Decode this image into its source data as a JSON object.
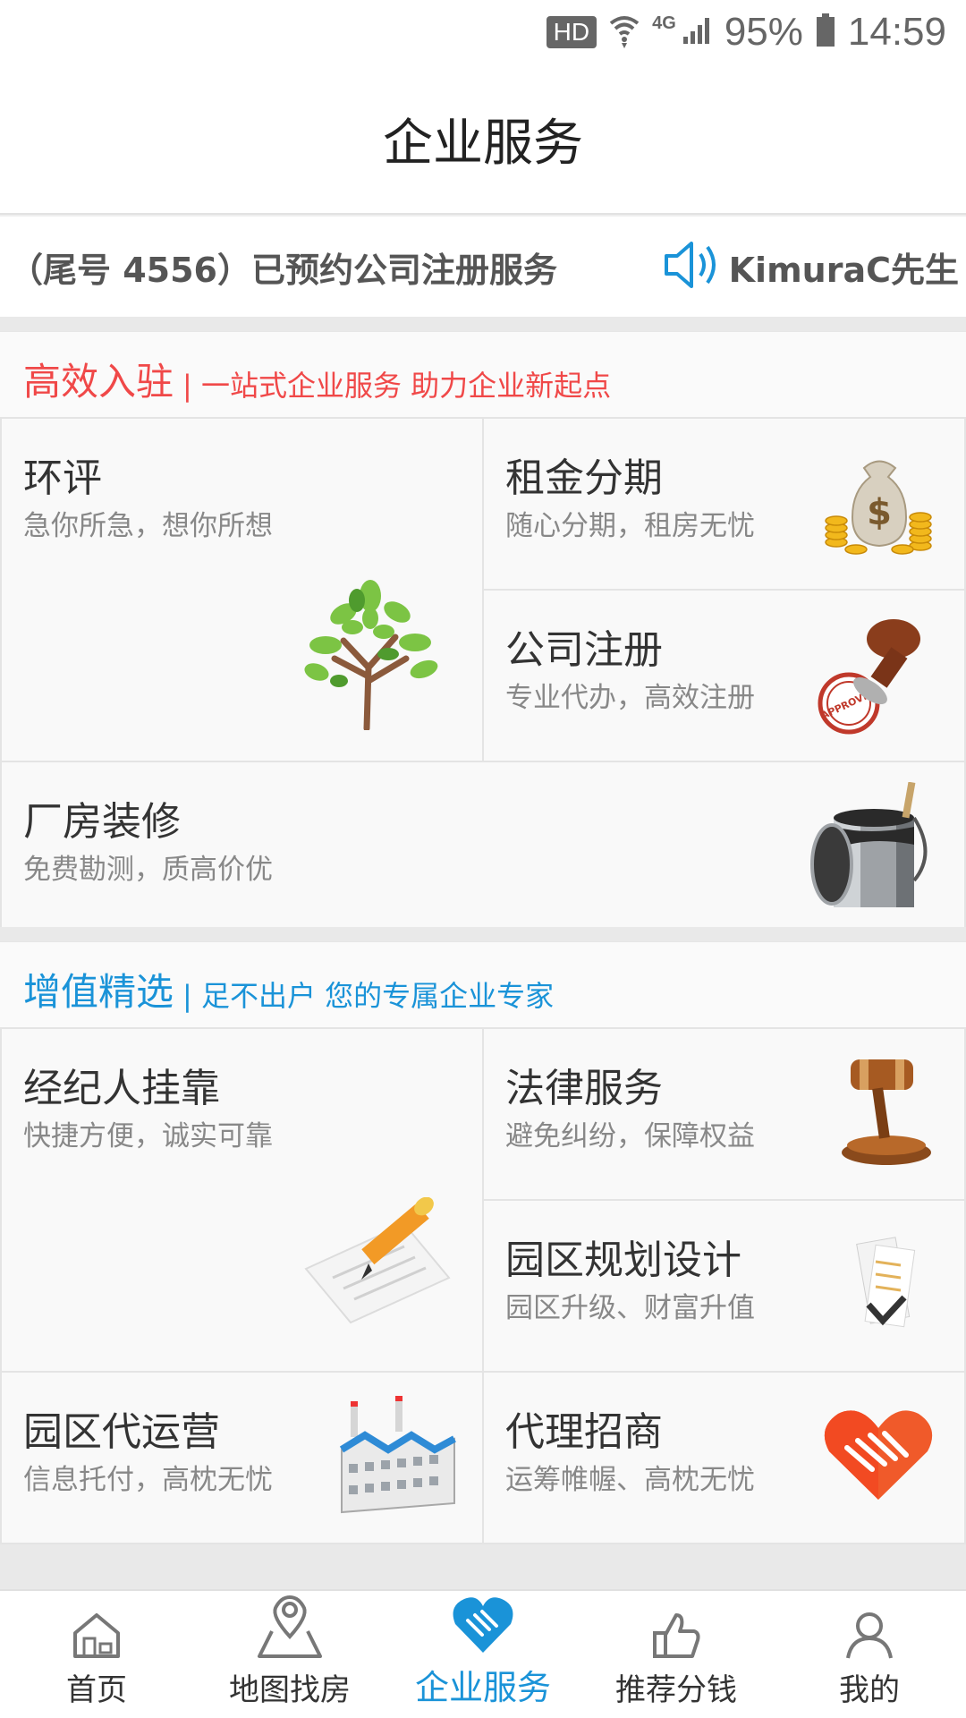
{
  "status_bar": {
    "hd": "HD",
    "network": "4G",
    "battery": "95%",
    "time": "14:59"
  },
  "page_title": "企业服务",
  "notice": {
    "text": "（尾号 4556）已预约公司注册服务",
    "user": "KimuraC先生"
  },
  "section1": {
    "title": "高效入驻",
    "subtitle": "| 一站式企业服务 助力企业新起点",
    "items": [
      {
        "title": "环评",
        "subtitle": "急你所急，想你所想",
        "icon": "tree-icon"
      },
      {
        "title": "租金分期",
        "subtitle": "随心分期，租房无忧",
        "icon": "money-bag-icon"
      },
      {
        "title": "公司注册",
        "subtitle": "专业代办，高效注册",
        "icon": "stamp-icon"
      },
      {
        "title": "厂房装修",
        "subtitle": "免费勘测，质高价优",
        "icon": "paint-bucket-icon"
      }
    ]
  },
  "section2": {
    "title": "增值精选",
    "subtitle": "| 足不出户 您的专属企业专家",
    "items": [
      {
        "title": "经纪人挂靠",
        "subtitle": "快捷方便，诚实可靠",
        "icon": "pencil-paper-icon"
      },
      {
        "title": "法律服务",
        "subtitle": "避免纠纷，保障权益",
        "icon": "gavel-icon"
      },
      {
        "title": "园区规划设计",
        "subtitle": "园区升级、财富升值",
        "icon": "blueprint-icon"
      },
      {
        "title": "园区代运营",
        "subtitle": "信息托付，高枕无忧",
        "icon": "factory-icon"
      },
      {
        "title": "代理招商",
        "subtitle": "运筹帷幄、高枕无忧",
        "icon": "heart-handshake-icon"
      }
    ]
  },
  "tabs": [
    {
      "label": "首页",
      "icon": "home-icon"
    },
    {
      "label": "地图找房",
      "icon": "map-pin-icon"
    },
    {
      "label": "企业服务",
      "icon": "handshake-heart-icon",
      "active": true
    },
    {
      "label": "推荐分钱",
      "icon": "thumbs-up-icon"
    },
    {
      "label": "我的",
      "icon": "user-icon"
    }
  ],
  "colors": {
    "accent_blue": "#1a93d8",
    "accent_red": "#f04848"
  }
}
